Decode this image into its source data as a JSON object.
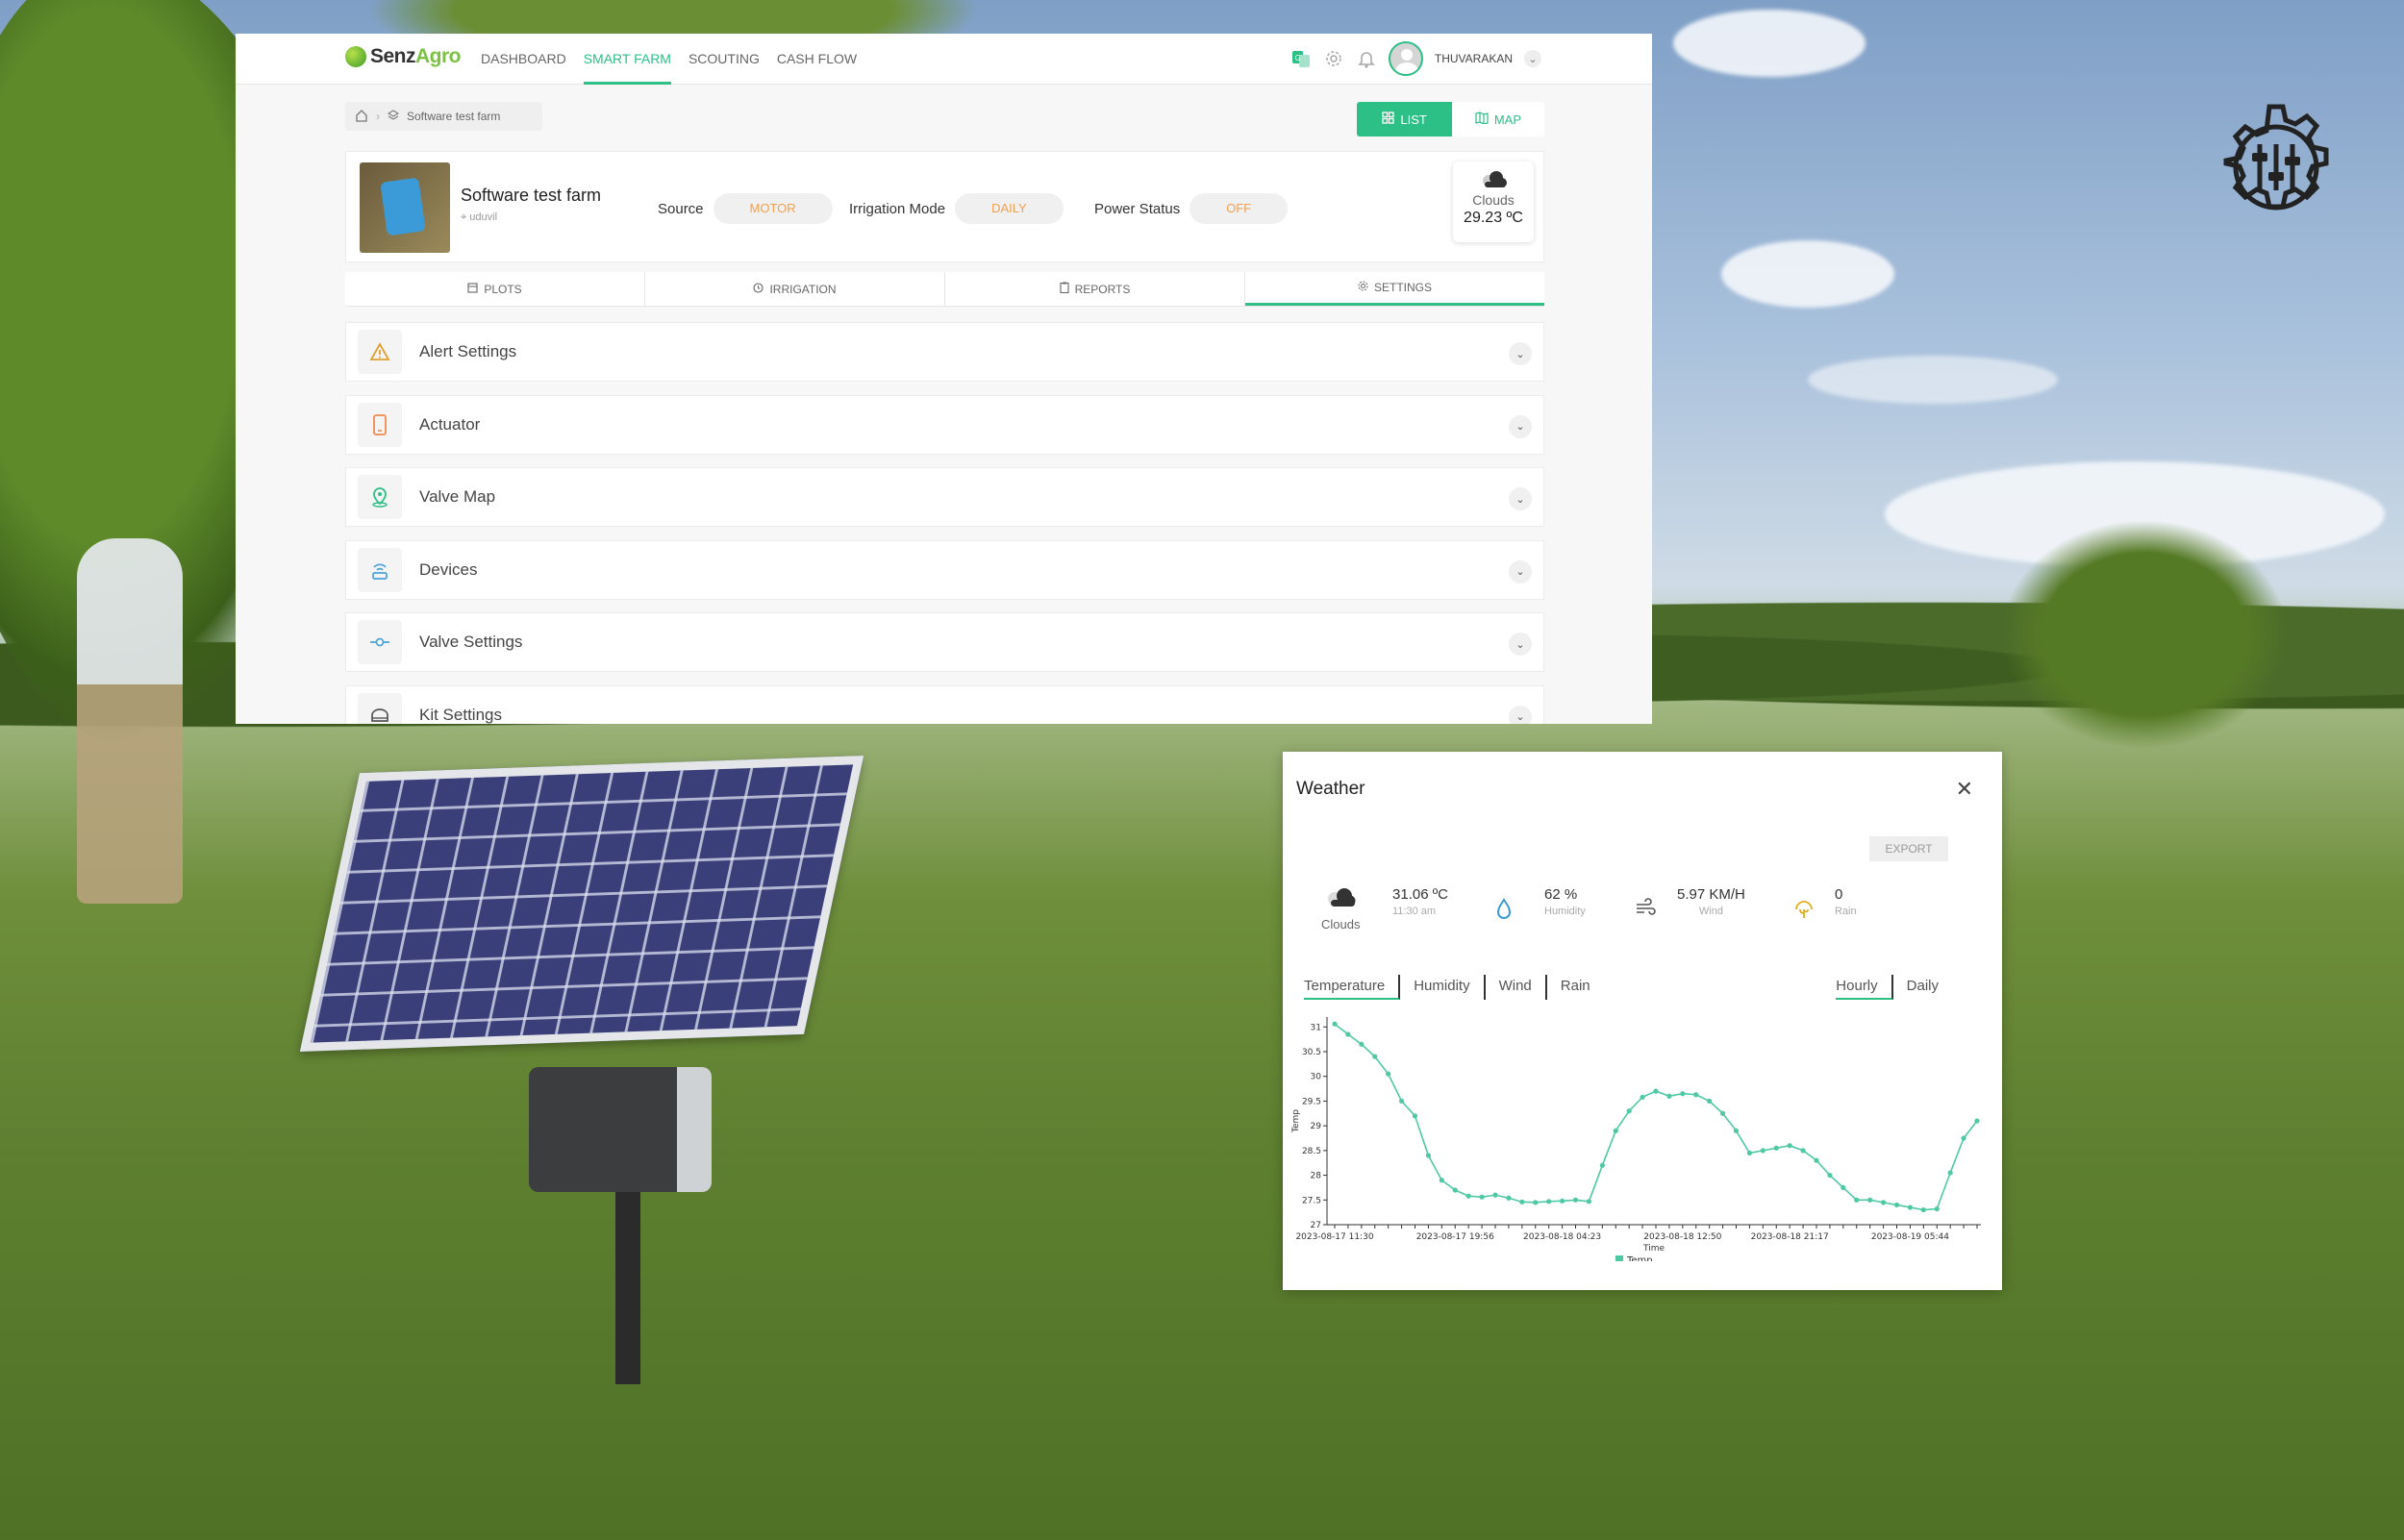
{
  "app": {
    "brand": {
      "name_part1": "Senz",
      "name_part2": "Agro"
    },
    "nav": [
      {
        "label": "DASHBOARD",
        "active": false
      },
      {
        "label": "SMART FARM",
        "active": true
      },
      {
        "label": "SCOUTING",
        "active": false
      },
      {
        "label": "CASH FLOW",
        "active": false
      }
    ],
    "user": {
      "name": "THUVARAKAN"
    },
    "breadcrumb": {
      "current": "Software test farm"
    },
    "view_toggle": {
      "list": "LIST",
      "map": "MAP"
    },
    "farm": {
      "name": "Software test farm",
      "location": "uduvil",
      "source_label": "Source",
      "source_value": "MOTOR",
      "irrigation_label": "Irrigation Mode",
      "irrigation_value": "DAILY",
      "power_label": "Power Status",
      "power_value": "OFF"
    },
    "mini_weather": {
      "condition": "Clouds",
      "temp": "29.23 ºC"
    },
    "tabs": [
      {
        "label": "PLOTS",
        "icon": "plots-icon",
        "active": false
      },
      {
        "label": "IRRIGATION",
        "icon": "clock-icon",
        "active": false
      },
      {
        "label": "REPORTS",
        "icon": "clipboard-icon",
        "active": false
      },
      {
        "label": "SETTINGS",
        "icon": "gear-icon",
        "active": true
      }
    ],
    "settings_sections": [
      {
        "label": "Alert Settings",
        "icon": "warning-icon",
        "color": "#e0a030"
      },
      {
        "label": "Actuator",
        "icon": "phone-icon",
        "color": "#f08a50"
      },
      {
        "label": "Valve Map",
        "icon": "map-pin-icon",
        "color": "#2cbf86"
      },
      {
        "label": "Devices",
        "icon": "router-icon",
        "color": "#4aa3d8"
      },
      {
        "label": "Valve Settings",
        "icon": "valve-icon",
        "color": "#4aa3d8"
      },
      {
        "label": "Kit Settings",
        "icon": "kit-icon",
        "color": "#555555"
      }
    ],
    "accent": "#2cbf86"
  },
  "weather_modal": {
    "title": "Weather",
    "export": "EXPORT",
    "current": {
      "condition": "Clouds",
      "temp": "31.06 ºC",
      "time": "11:30 am",
      "humidity_value": "62 %",
      "humidity_label": "Humidity",
      "wind_value": "5.97 KM/H",
      "wind_label": "Wind",
      "rain_value": "0",
      "rain_label": "Rain"
    },
    "metric_tabs": [
      {
        "label": "Temperature",
        "active": true
      },
      {
        "label": "Humidity",
        "active": false
      },
      {
        "label": "Wind",
        "active": false
      },
      {
        "label": "Rain",
        "active": false
      }
    ],
    "range_tabs": [
      {
        "label": "Hourly",
        "active": true
      },
      {
        "label": "Daily",
        "active": false
      }
    ]
  },
  "chart_data": {
    "type": "line",
    "title": "",
    "xlabel": "Time",
    "ylabel": "Temp",
    "ylim": [
      27,
      31.2
    ],
    "yticks": [
      "27",
      "27.5",
      "28",
      "28.5",
      "29",
      "29.5",
      "30",
      "30.5",
      "31"
    ],
    "xtick_labels": [
      "2023-08-17 11:30",
      "2023-08-17 19:56",
      "2023-08-18 04:23",
      "2023-08-18 12:50",
      "2023-08-18 21:17",
      "2023-08-19 05:44"
    ],
    "legend": "bottom-center",
    "series": [
      {
        "name": "Temp",
        "color": "#4fc9a4",
        "values": [
          31.06,
          30.85,
          30.65,
          30.4,
          30.05,
          29.5,
          29.2,
          28.4,
          27.9,
          27.7,
          27.58,
          27.56,
          27.6,
          27.54,
          27.46,
          27.45,
          27.47,
          27.48,
          27.5,
          27.47,
          28.2,
          28.9,
          29.3,
          29.58,
          29.7,
          29.6,
          29.65,
          29.63,
          29.5,
          29.25,
          28.9,
          28.45,
          28.5,
          28.55,
          28.6,
          28.5,
          28.3,
          28.0,
          27.75,
          27.5,
          27.5,
          27.45,
          27.4,
          27.35,
          27.3,
          27.32,
          28.05,
          28.75,
          29.1
        ]
      }
    ]
  }
}
